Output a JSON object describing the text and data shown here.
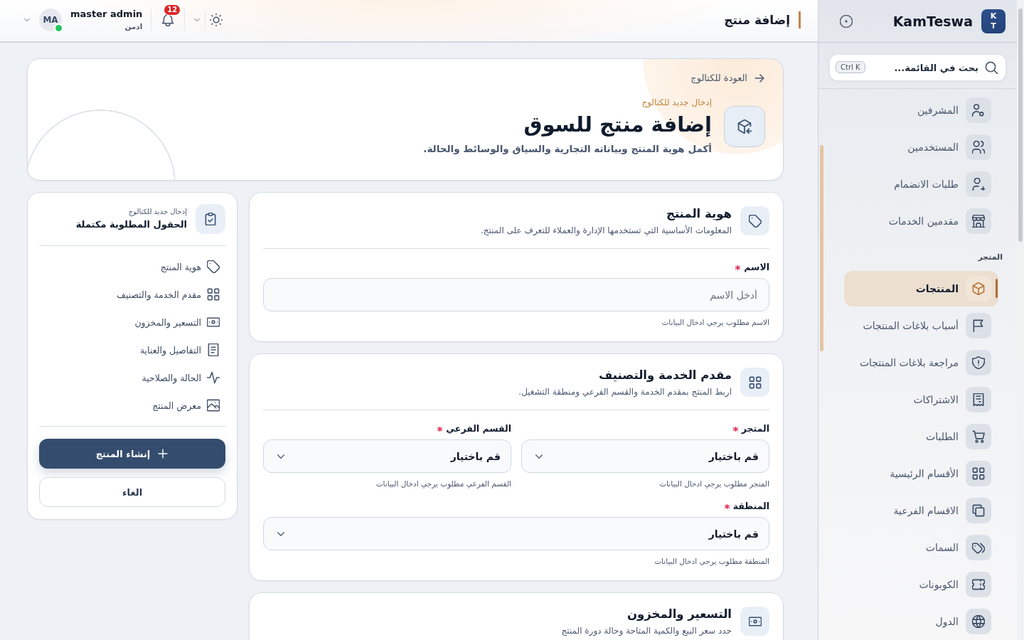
{
  "topbar": {
    "page_title": "إضافة منتج",
    "notification_count": "12",
    "user": {
      "name": "master admin",
      "role": "ادمن",
      "initials": "MA",
      "online": true
    }
  },
  "sidebar": {
    "brand": {
      "logo_letters": "KT",
      "name": "KamTeswa"
    },
    "search": {
      "placeholder": "بحث في القائمة...",
      "shortcut": "Ctrl K"
    },
    "sections": [
      {
        "items": [
          {
            "label": "المشرفين",
            "selected": false
          },
          {
            "label": "المستخدمين",
            "selected": false
          },
          {
            "label": "طلبات الانضمام",
            "selected": false
          },
          {
            "label": "مقدمين الخدمات",
            "selected": false
          }
        ]
      },
      {
        "heading": "المتجر",
        "items": [
          {
            "label": "المنتجات",
            "selected": true
          },
          {
            "label": "أسباب بلاغات المنتجات",
            "selected": false
          },
          {
            "label": "مراجعة بلاغات المنتجات",
            "selected": false
          },
          {
            "label": "الاشتراكات",
            "selected": false
          },
          {
            "label": "الطلبات",
            "selected": false
          },
          {
            "label": "الأقسام الرئيسية",
            "selected": false
          },
          {
            "label": "الاقسام الفرعية",
            "selected": false
          },
          {
            "label": "السمات",
            "selected": false
          },
          {
            "label": "الكوبونات",
            "selected": false
          },
          {
            "label": "الدول",
            "selected": false
          }
        ]
      }
    ]
  },
  "page_header": {
    "back_link": "العودة للكتالوج",
    "eyebrow": "إدخال جديد للكتالوج",
    "title": "إضافة منتج للسوق",
    "subtitle": "أكمل هوية المنتج وبياناته التجارية والسياق والوسائط والحالة."
  },
  "form_sections": [
    {
      "title": "هوية المنتج",
      "description": "المعلومات الأساسية التي تستخدمها الإدارة والعملاء للتعرف على المنتج.",
      "rows": [
        [
          {
            "kind": "text",
            "label": "الاسم",
            "required": true,
            "placeholder": "أدخل الاسم",
            "helper": "الاسم مطلوب يرجي ادخال البيانات"
          }
        ]
      ]
    },
    {
      "title": "مقدم الخدمة والتصنيف",
      "description": "اربط المنتج بمقدم الخدمة والقسم الفرعي ومنطقة التشغيل.",
      "rows": [
        [
          {
            "kind": "select",
            "label": "المتجر",
            "required": true,
            "placeholder": "قم باختيار",
            "helper": "المتجر مطلوب يرجي ادخال البيانات"
          },
          {
            "kind": "select",
            "label": "القسم الفرعي",
            "required": true,
            "placeholder": "قم باختيار",
            "helper": "القسم الفرعي مطلوب يرجي ادخال البيانات"
          }
        ],
        [
          {
            "kind": "select",
            "label": "المنطقة",
            "required": true,
            "placeholder": "قم باختيار",
            "helper": "المنطقة مطلوب يرجي ادخال البيانات"
          }
        ]
      ]
    },
    {
      "title": "التسعير والمخزون",
      "description": "حدد سعر البيع والكمية المتاحة وحالة دورة المنتج"
    }
  ],
  "summary": {
    "eyebrow": "إدخال جديد للكتالوج",
    "title": "الحقول المطلوبة مكتملة",
    "sections": [
      "هوية المنتج",
      "مقدم الخدمة والتصنيف",
      "التسعير والمخزون",
      "التفاصيل والعناية",
      "الحالة والصلاحية",
      "معرض المنتج"
    ],
    "primary_button": "إنشاء المنتج",
    "cancel_button": "الغاء"
  }
}
